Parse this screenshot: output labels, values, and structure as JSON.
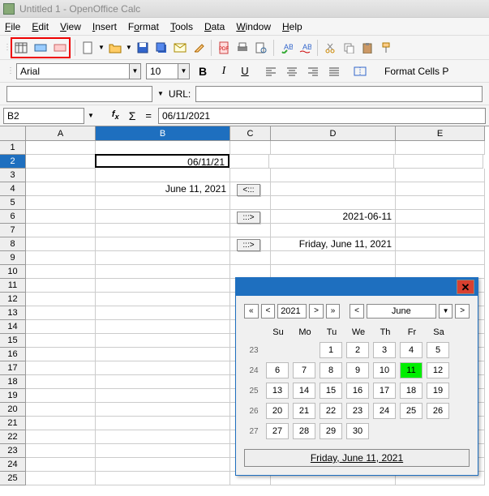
{
  "title": "Untitled 1 - OpenOffice Calc",
  "menus": [
    "File",
    "Edit",
    "View",
    "Insert",
    "Format",
    "Tools",
    "Data",
    "Window",
    "Help"
  ],
  "font": {
    "name": "Arial",
    "size": "10"
  },
  "format_cells_label": "Format Cells  P",
  "url_label": "URL:",
  "cell_ref": "B2",
  "formula": "06/11/2021",
  "columns": [
    "A",
    "B",
    "C",
    "D",
    "E"
  ],
  "selected_col": "B",
  "selected_row": 2,
  "row_count": 25,
  "cells": {
    "B2": "06/11/21",
    "B4": "June 11, 2021",
    "C4": "<:::",
    "C6": ":::>",
    "D6": "2021-06-11",
    "C8": ":::>",
    "D8": "Friday, June 11, 2021"
  },
  "calendar": {
    "year": "2021",
    "month": "June",
    "day_headers": [
      "Su",
      "Mo",
      "Tu",
      "We",
      "Th",
      "Fr",
      "Sa"
    ],
    "weeks": [
      {
        "wn": 23,
        "days": [
          "",
          "",
          "",
          1,
          2,
          3,
          4,
          5
        ]
      },
      {
        "wn": 24,
        "days": [
          6,
          7,
          8,
          9,
          10,
          11,
          12
        ]
      },
      {
        "wn": 25,
        "days": [
          13,
          14,
          15,
          16,
          17,
          18,
          19
        ]
      },
      {
        "wn": 26,
        "days": [
          20,
          21,
          22,
          23,
          24,
          25,
          26
        ]
      },
      {
        "wn": 27,
        "days": [
          27,
          28,
          29,
          30,
          "",
          "",
          ""
        ]
      }
    ],
    "today": 11,
    "footer": "Friday, June 11, 2021"
  }
}
